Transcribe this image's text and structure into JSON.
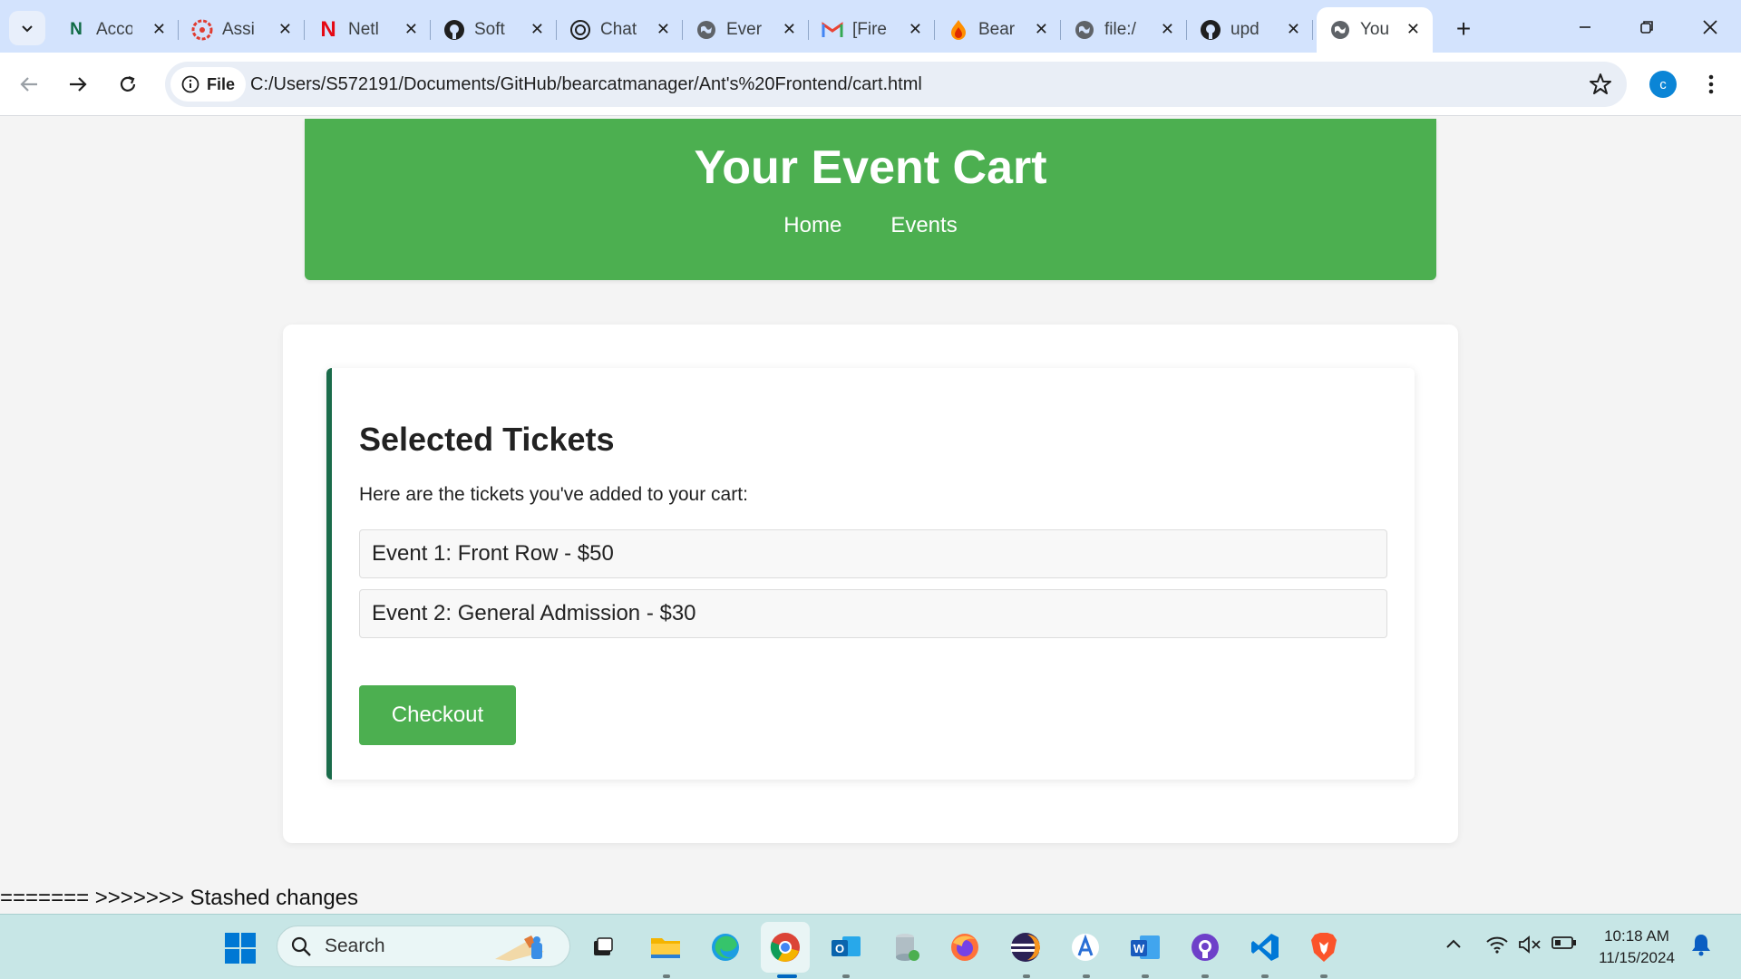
{
  "browser": {
    "tabs": [
      {
        "label": "Acco",
        "icon": "notion-n-icon",
        "active": false
      },
      {
        "label": "Assi",
        "icon": "canvas-icon",
        "active": false
      },
      {
        "label": "Netl",
        "icon": "netflix-n-icon",
        "active": false
      },
      {
        "label": "Soft",
        "icon": "github-icon",
        "active": false
      },
      {
        "label": "Chat",
        "icon": "chatgpt-icon",
        "active": false
      },
      {
        "label": "Ever",
        "icon": "globe-icon",
        "active": false
      },
      {
        "label": "[Fire",
        "icon": "gmail-icon",
        "active": false
      },
      {
        "label": "Bear",
        "icon": "firebase-icon",
        "active": false
      },
      {
        "label": "file:/",
        "icon": "globe-icon",
        "active": false
      },
      {
        "label": "upd",
        "icon": "github-icon",
        "active": false
      },
      {
        "label": "Your",
        "icon": "globe-icon",
        "active": true
      }
    ],
    "address": {
      "chip_label": "File",
      "url": "C:/Users/S572191/Documents/GitHub/bearcatmanager/Ant's%20Frontend/cart.html"
    },
    "profile_initial": "c"
  },
  "page": {
    "header": {
      "title": "Your Event Cart",
      "nav": [
        "Home",
        "Events"
      ]
    },
    "section": {
      "title": "Selected Tickets",
      "description": "Here are the tickets you've added to your cart:",
      "tickets": [
        "Event 1: Front Row - $50",
        "Event 2: General Admission - $30"
      ],
      "checkout_label": "Checkout"
    },
    "stray_text": "======= >>>>>>> Stashed changes"
  },
  "taskbar": {
    "search_placeholder": "Search",
    "apps": [
      "task-view-icon",
      "file-explorer-icon",
      "edge-icon",
      "chrome-icon",
      "outlook-icon",
      "database-icon",
      "firefox-icon",
      "eclipse-icon",
      "app-store-icon",
      "word-icon",
      "github-desktop-icon",
      "vscode-icon",
      "brave-icon"
    ],
    "clock": {
      "time": "10:18 AM",
      "date": "11/15/2024"
    }
  },
  "colors": {
    "header_green": "#4caf50",
    "section_border": "#1a6b4a",
    "tabstrip": "#d3e3fd"
  }
}
